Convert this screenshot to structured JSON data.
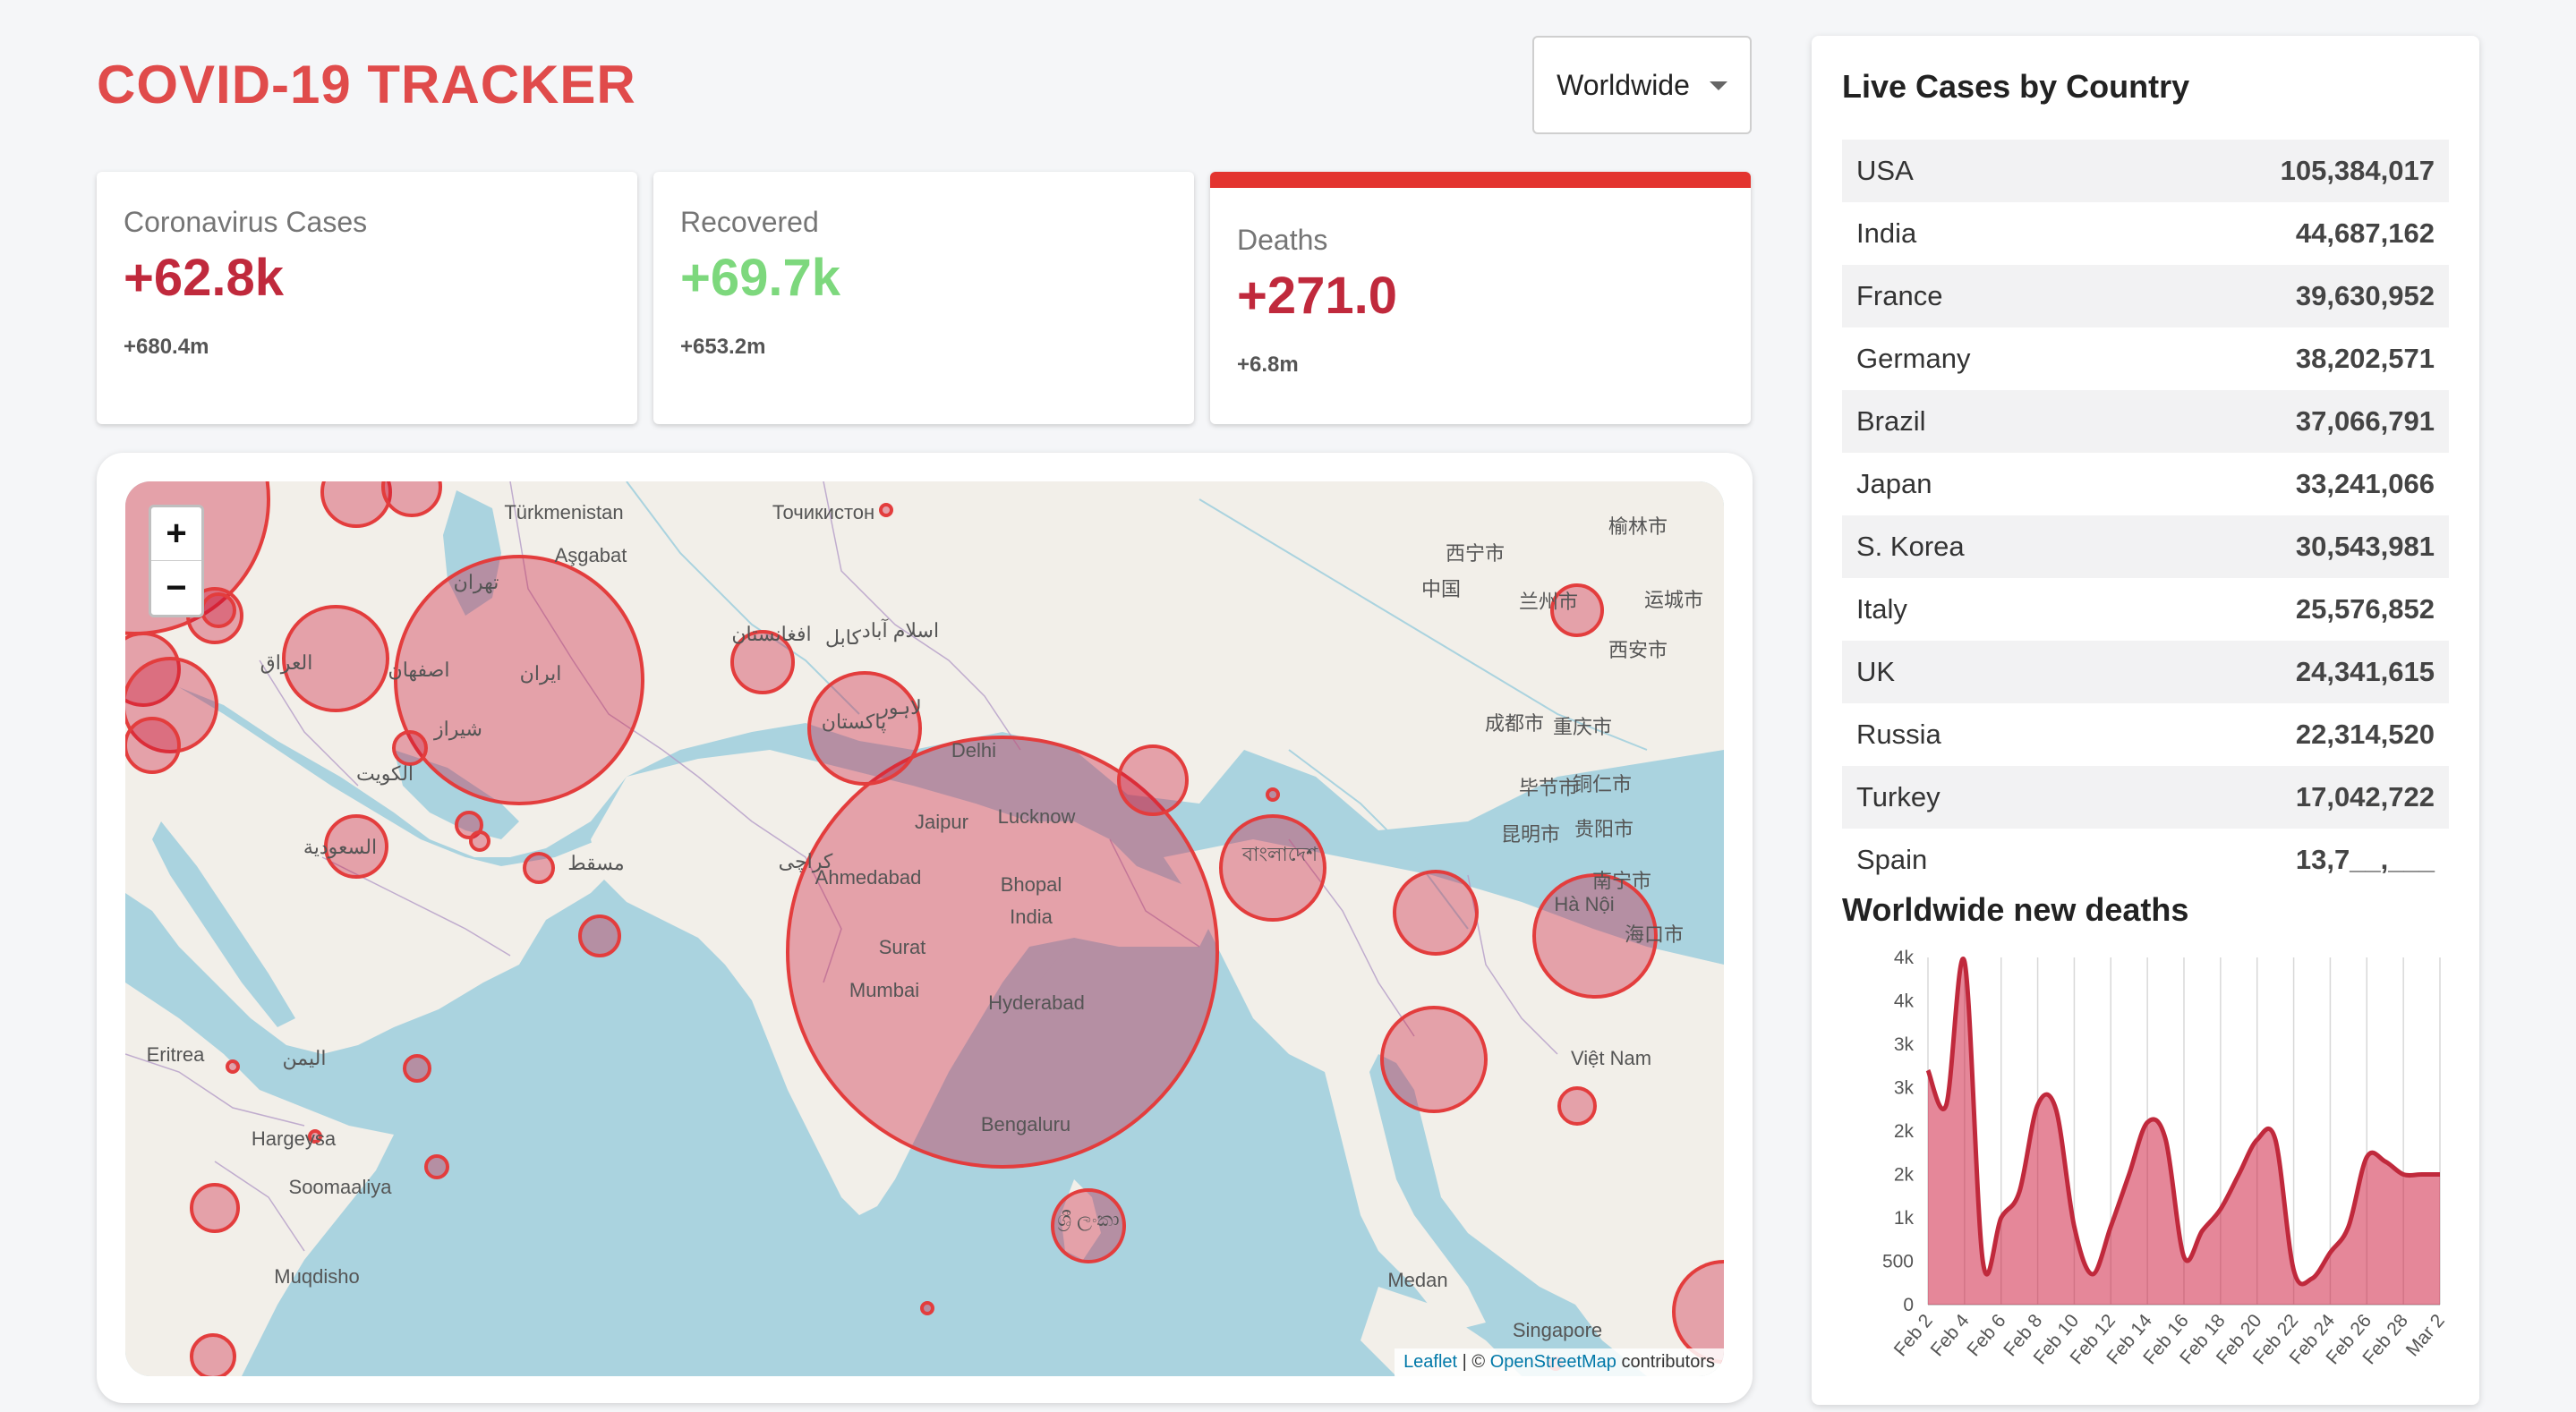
{
  "header": {
    "title": "COVID-19 TRACKER",
    "country_select": "Worldwide"
  },
  "stats": [
    {
      "title": "Coronavirus Cases",
      "value": "+62.8k",
      "total": "+680.4m",
      "color": "#c0293c",
      "active": false
    },
    {
      "title": "Recovered",
      "value": "+69.7k",
      "total": "+653.2m",
      "color": "#7dd87d",
      "active": false
    },
    {
      "title": "Deaths",
      "value": "+271.0",
      "total": "+6.8m",
      "color": "#c0293c",
      "active": true
    }
  ],
  "map": {
    "zoom_in": "+",
    "zoom_out": "−",
    "attribution": {
      "leaflet": "Leaflet",
      "separator": " | © ",
      "osm": "OpenStreetMap",
      "suffix": " contributors"
    },
    "labels": [
      "Türkmenistan",
      "Aşgabat",
      "Точикистон",
      "Delhi",
      "Jaipur",
      "Lucknow",
      "Ahmedabad",
      "Bhopal",
      "India",
      "Surat",
      "Mumbai",
      "Hyderabad",
      "Bengaluru",
      "Eritrea",
      "Hargeysa",
      "Soomaaliya",
      "Muqdisho",
      "Medan",
      "Singapore",
      "Hà Nội",
      "Việt Nam",
      "中国",
      "西宁市",
      "兰州市",
      "榆林市",
      "运城市",
      "西安市",
      "成都市",
      "重庆市",
      "毕节市",
      "铜仁市",
      "昆明市",
      "贵阳市",
      "南宁市",
      "海口市",
      "تهران",
      "ایران",
      "اصفهان",
      "شیراز",
      "العراق",
      "الكويت",
      "السعودية",
      "مسقط",
      "پاکستان",
      "افغانستان",
      "کابل",
      "اسلام آباد",
      "لاہور",
      "کراچی",
      "বাংলাদেশ",
      "ශ්‍රී ලංකා",
      "اليمن"
    ]
  },
  "sidebar": {
    "live_title": "Live Cases by Country",
    "countries": [
      {
        "name": "USA",
        "cases": "105,384,017"
      },
      {
        "name": "India",
        "cases": "44,687,162"
      },
      {
        "name": "France",
        "cases": "39,630,952"
      },
      {
        "name": "Germany",
        "cases": "38,202,571"
      },
      {
        "name": "Brazil",
        "cases": "37,066,791"
      },
      {
        "name": "Japan",
        "cases": "33,241,066"
      },
      {
        "name": "S. Korea",
        "cases": "30,543,981"
      },
      {
        "name": "Italy",
        "cases": "25,576,852"
      },
      {
        "name": "UK",
        "cases": "24,341,615"
      },
      {
        "name": "Russia",
        "cases": "22,314,520"
      },
      {
        "name": "Turkey",
        "cases": "17,042,722"
      },
      {
        "name": "Spain",
        "cases": "13,7__,___"
      }
    ],
    "chart_title": "Worldwide new deaths"
  },
  "chart_data": {
    "type": "area",
    "title": "Worldwide new deaths",
    "color": "#c0293c",
    "fill": "rgba(204, 16, 52, 0.5)",
    "ylim": [
      0,
      4000
    ],
    "y_ticks": [
      "0",
      "500",
      "1k",
      "2k",
      "2k",
      "3k",
      "3k",
      "4k",
      "4k"
    ],
    "x_ticks": [
      "Feb 2",
      "Feb 4",
      "Feb 6",
      "Feb 8",
      "Feb 10",
      "Feb 12",
      "Feb 14",
      "Feb 16",
      "Feb 18",
      "Feb 20",
      "Feb 22",
      "Feb 24",
      "Feb 26",
      "Feb 28",
      "Mar 2"
    ],
    "x": [
      "Feb 2",
      "Feb 3",
      "Feb 4",
      "Feb 5",
      "Feb 6",
      "Feb 7",
      "Feb 8",
      "Feb 9",
      "Feb 10",
      "Feb 11",
      "Feb 12",
      "Feb 13",
      "Feb 14",
      "Feb 15",
      "Feb 16",
      "Feb 17",
      "Feb 18",
      "Feb 19",
      "Feb 20",
      "Feb 21",
      "Feb 22",
      "Feb 23",
      "Feb 24",
      "Feb 25",
      "Feb 26",
      "Feb 27",
      "Feb 28",
      "Mar 1",
      "Mar 2"
    ],
    "values": [
      2700,
      2300,
      3950,
      500,
      1000,
      1300,
      2300,
      2250,
      900,
      350,
      900,
      1500,
      2100,
      1900,
      550,
      850,
      1100,
      1500,
      1900,
      1900,
      400,
      300,
      600,
      900,
      1700,
      1650,
      1500,
      1500,
      1500
    ]
  }
}
